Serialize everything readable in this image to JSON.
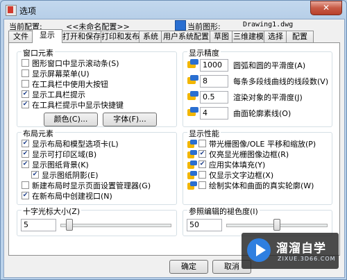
{
  "window": {
    "title": "选项",
    "close_glyph": "✕"
  },
  "header": {
    "current_profile_label": "当前配置:",
    "current_profile_value": "<<未命名配置>>",
    "current_drawing_label": "当前图形:",
    "current_drawing_value": "Drawing1.dwg"
  },
  "tabs": [
    "文件",
    "显示",
    "打开和保存",
    "打印和发布",
    "系统",
    "用户系统配置",
    "草图",
    "三维建模",
    "选择",
    "配置"
  ],
  "active_tab": "显示",
  "window_elements": {
    "title": "窗口元素",
    "items": [
      {
        "label": "图形窗口中显示滚动条(S)",
        "checked": false
      },
      {
        "label": "显示屏幕菜单(U)",
        "checked": false
      },
      {
        "label": "在工具栏中使用大按钮",
        "checked": false
      },
      {
        "label": "显示工具栏提示",
        "checked": true
      },
      {
        "label": "在工具栏提示中显示快捷键",
        "checked": true
      }
    ],
    "colors_button": "颜色(C)...",
    "fonts_button": "字体(F)..."
  },
  "display_resolution": {
    "title": "显示精度",
    "items": [
      {
        "value": "1000",
        "label": "圆弧和圆的平滑度(A)"
      },
      {
        "value": "8",
        "label": "每条多段线曲线的线段数(V)"
      },
      {
        "value": "0.5",
        "label": "渲染对象的平滑度(J)"
      },
      {
        "value": "4",
        "label": "曲面轮廓素线(O)"
      }
    ]
  },
  "layout_elements": {
    "title": "布局元素",
    "items": [
      {
        "label": "显示布局和模型选项卡(L)",
        "checked": true
      },
      {
        "label": "显示可打印区域(B)",
        "checked": true
      },
      {
        "label": "显示图纸背景(K)",
        "checked": true
      },
      {
        "label": "显示图纸阴影(E)",
        "checked": true
      },
      {
        "label": "新建布局时显示页面设置管理器(G)",
        "checked": false
      },
      {
        "label": "在新布局中创建视口(N)",
        "checked": true
      }
    ]
  },
  "display_performance": {
    "title": "显示性能",
    "items": [
      {
        "label": "带光栅图像/OLE 平移和缩放(P)",
        "checked": false
      },
      {
        "label": "仅亮显光栅图像边框(R)",
        "checked": true
      },
      {
        "label": "应用实体填充(Y)",
        "checked": true
      },
      {
        "label": "仅显示文字边框(X)",
        "checked": false
      },
      {
        "label": "绘制实体和曲面的真实轮廓(W)",
        "checked": false
      }
    ]
  },
  "crosshair_size": {
    "title": "十字光标大小(Z)",
    "value": "5",
    "slider_fraction": 0.05
  },
  "xref_fading": {
    "title": "参照编辑的褪色度(I)",
    "value": "50",
    "slider_fraction": 0.5
  },
  "footer": {
    "ok": "确定",
    "cancel": "取消"
  },
  "watermark": {
    "brand": "溜溜自学",
    "url": "ZIXUE.3D66.COM"
  }
}
